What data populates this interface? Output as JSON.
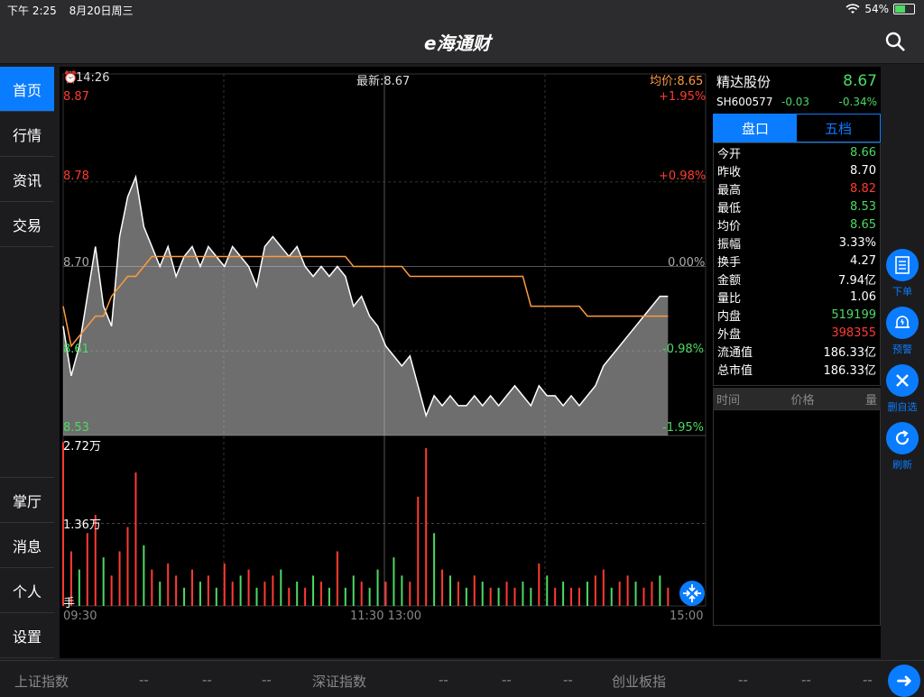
{
  "status": {
    "time": "下午 2:25",
    "date": "8月20日周三",
    "battery": "54%",
    "battery_level": 0.54
  },
  "nav": {
    "logo": "e海通财"
  },
  "sidebar": {
    "top": [
      {
        "label": "首页",
        "active": true
      },
      {
        "label": "行情"
      },
      {
        "label": "资讯"
      },
      {
        "label": "交易"
      }
    ],
    "bottom": [
      {
        "label": "掌厅"
      },
      {
        "label": "消息"
      },
      {
        "label": "个人"
      },
      {
        "label": "设置"
      }
    ]
  },
  "chart_header": {
    "time": "14:26",
    "latest": "最新:8.67",
    "avg": "均价:8.65"
  },
  "chart_data": {
    "type": "line",
    "price_labels_left": [
      "8.87",
      "8.78",
      "8.70",
      "8.61",
      "8.53"
    ],
    "pct_labels_right": [
      "+1.95%",
      "+0.98%",
      "0.00%",
      "-0.98%",
      "-1.95%"
    ],
    "ylim": [
      8.53,
      8.87
    ],
    "vol_labels": [
      "2.72万",
      "1.36万",
      "手"
    ],
    "vol_max": 27200,
    "xticks": [
      "09:30",
      "11:30 13:00",
      "15:00"
    ],
    "price": [
      8.64,
      8.59,
      8.62,
      8.67,
      8.72,
      8.66,
      8.64,
      8.73,
      8.77,
      8.79,
      8.74,
      8.72,
      8.7,
      8.72,
      8.69,
      8.71,
      8.72,
      8.7,
      8.72,
      8.71,
      8.7,
      8.72,
      8.71,
      8.7,
      8.68,
      8.72,
      8.73,
      8.72,
      8.71,
      8.72,
      8.7,
      8.69,
      8.7,
      8.69,
      8.7,
      8.69,
      8.66,
      8.67,
      8.65,
      8.64,
      8.62,
      8.61,
      8.6,
      8.61,
      8.58,
      8.55,
      8.57,
      8.56,
      8.57,
      8.56,
      8.56,
      8.57,
      8.56,
      8.57,
      8.56,
      8.57,
      8.58,
      8.57,
      8.56,
      8.58,
      8.57,
      8.57,
      8.56,
      8.57,
      8.56,
      8.57,
      8.58,
      8.6,
      8.61,
      8.62,
      8.63,
      8.64,
      8.65,
      8.66,
      8.67,
      8.67
    ],
    "avg": [
      8.66,
      8.62,
      8.63,
      8.64,
      8.65,
      8.65,
      8.67,
      8.68,
      8.69,
      8.69,
      8.7,
      8.71,
      8.71,
      8.71,
      8.71,
      8.71,
      8.71,
      8.71,
      8.71,
      8.71,
      8.71,
      8.71,
      8.71,
      8.71,
      8.71,
      8.71,
      8.71,
      8.71,
      8.71,
      8.71,
      8.71,
      8.71,
      8.71,
      8.71,
      8.71,
      8.71,
      8.7,
      8.7,
      8.7,
      8.7,
      8.7,
      8.7,
      8.7,
      8.69,
      8.69,
      8.69,
      8.69,
      8.69,
      8.69,
      8.69,
      8.69,
      8.69,
      8.69,
      8.69,
      8.69,
      8.69,
      8.69,
      8.69,
      8.66,
      8.66,
      8.66,
      8.66,
      8.66,
      8.66,
      8.66,
      8.65,
      8.65,
      8.65,
      8.65,
      8.65,
      8.65,
      8.65,
      8.65,
      8.65,
      8.65,
      8.65
    ],
    "volume": [
      27000,
      9000,
      6000,
      12000,
      15000,
      8000,
      5000,
      9000,
      13000,
      22000,
      10000,
      6000,
      4000,
      7000,
      5000,
      3000,
      6000,
      4000,
      5000,
      3000,
      7000,
      4000,
      5000,
      6000,
      3000,
      4000,
      5000,
      6000,
      3000,
      4000,
      3000,
      5000,
      4000,
      3000,
      9000,
      3000,
      5000,
      4000,
      3000,
      6000,
      4000,
      8000,
      5000,
      4000,
      18000,
      26000,
      12000,
      6000,
      5000,
      4000,
      3000,
      5000,
      4000,
      3000,
      3000,
      4000,
      3000,
      4000,
      3000,
      7000,
      5000,
      3000,
      4000,
      3000,
      3000,
      4000,
      5000,
      6000,
      3000,
      4000,
      5000,
      4000,
      3000,
      4000,
      5000,
      3000
    ],
    "vol_up": [
      1,
      1,
      0,
      1,
      1,
      0,
      1,
      1,
      1,
      1,
      0,
      1,
      0,
      1,
      1,
      0,
      1,
      0,
      1,
      0,
      1,
      1,
      0,
      1,
      0,
      1,
      1,
      0,
      1,
      0,
      1,
      0,
      1,
      0,
      1,
      0,
      0,
      1,
      0,
      0,
      1,
      0,
      0,
      1,
      1,
      1,
      0,
      1,
      0,
      1,
      0,
      1,
      0,
      1,
      0,
      1,
      1,
      0,
      0,
      1,
      0,
      1,
      0,
      1,
      1,
      0,
      1,
      1,
      0,
      1,
      1,
      0,
      1,
      1,
      0,
      1
    ]
  },
  "panel": {
    "name": "精达股份",
    "price": "8.67",
    "code": "SH600577",
    "change": "-0.03",
    "pct": "-0.34%",
    "tabs": [
      "盘口",
      "五档"
    ],
    "stats": [
      {
        "label": "今开",
        "value": "8.66",
        "color": "#4cd964"
      },
      {
        "label": "昨收",
        "value": "8.70",
        "color": "#ffffff"
      },
      {
        "label": "最高",
        "value": "8.82",
        "color": "#ff3b30"
      },
      {
        "label": "最低",
        "value": "8.53",
        "color": "#4cd964"
      },
      {
        "label": "均价",
        "value": "8.65",
        "color": "#4cd964"
      },
      {
        "label": "振幅",
        "value": "3.33%",
        "color": "#ffffff"
      },
      {
        "label": "换手",
        "value": "4.27",
        "color": "#ffffff"
      },
      {
        "label": "金额",
        "value": "7.94亿",
        "color": "#ffffff"
      },
      {
        "label": "量比",
        "value": "1.06",
        "color": "#ffffff"
      },
      {
        "label": "内盘",
        "value": "519199",
        "color": "#4cd964"
      },
      {
        "label": "外盘",
        "value": "398355",
        "color": "#ff3b30"
      },
      {
        "label": "流通值",
        "value": "186.33亿",
        "color": "#ffffff"
      },
      {
        "label": "总市值",
        "value": "186.33亿",
        "color": "#ffffff"
      }
    ],
    "trades_head": [
      "时间",
      "价格",
      "量"
    ]
  },
  "actions": [
    {
      "label": "下单",
      "icon": "order-icon"
    },
    {
      "label": "预警",
      "icon": "bell-icon"
    },
    {
      "label": "删自选",
      "icon": "close-icon"
    },
    {
      "label": "刷新",
      "icon": "refresh-icon"
    }
  ],
  "ticker": {
    "sh": "上证指数",
    "sz": "深证指数",
    "cy": "创业板指",
    "dash": "--"
  },
  "colors": {
    "accent": "#0a7cff",
    "up": "#ff3b30",
    "down": "#4cd964",
    "avg_line": "#ff9a3c"
  }
}
